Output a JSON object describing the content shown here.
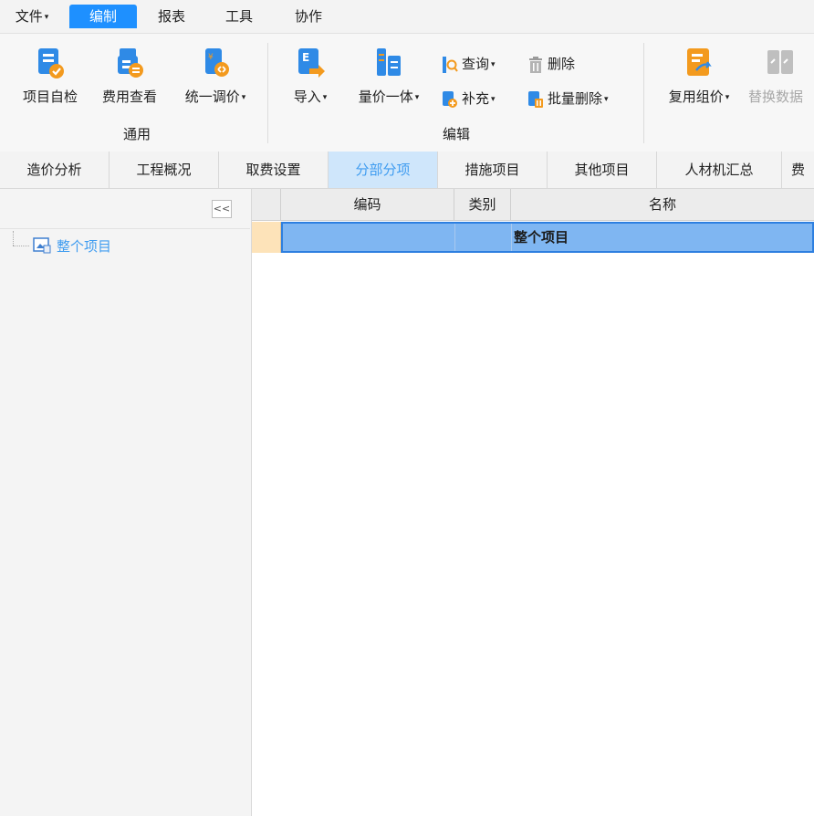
{
  "menubar": {
    "items": [
      {
        "label": "文件",
        "has_caret": true
      },
      {
        "label": "编制",
        "active": true
      },
      {
        "label": "报表"
      },
      {
        "label": "工具"
      },
      {
        "label": "协作"
      }
    ]
  },
  "ribbon": {
    "groups": [
      {
        "label": "通用"
      },
      {
        "label": "编辑"
      }
    ],
    "buttons": {
      "self_check": "项目自检",
      "cost_view": "费用查看",
      "unify_price": "统一调价",
      "import": "导入",
      "qty_price": "量价一体",
      "query": "查询",
      "delete": "删除",
      "supplement": "补充",
      "batch_delete": "批量删除",
      "reuse_group": "复用组价",
      "replace_data": "替换数据"
    }
  },
  "tabs": [
    {
      "label": "造价分析"
    },
    {
      "label": "工程概况"
    },
    {
      "label": "取费设置"
    },
    {
      "label": "分部分项",
      "active": true
    },
    {
      "label": "措施项目"
    },
    {
      "label": "其他项目"
    },
    {
      "label": "人材机汇总"
    },
    {
      "label": "费"
    }
  ],
  "tree": {
    "collapse_label": "<<",
    "root": "整个项目"
  },
  "grid": {
    "columns": [
      "编码",
      "类别",
      "名称"
    ],
    "rows": [
      {
        "code": "",
        "type": "",
        "name": "整个项目"
      }
    ]
  },
  "colors": {
    "accent": "#1e90ff",
    "active_tab_bg": "#cfe6fb",
    "selected_row": "#7fb6f2",
    "icon_blue": "#2f8ae6",
    "icon_orange": "#f39a1e"
  }
}
